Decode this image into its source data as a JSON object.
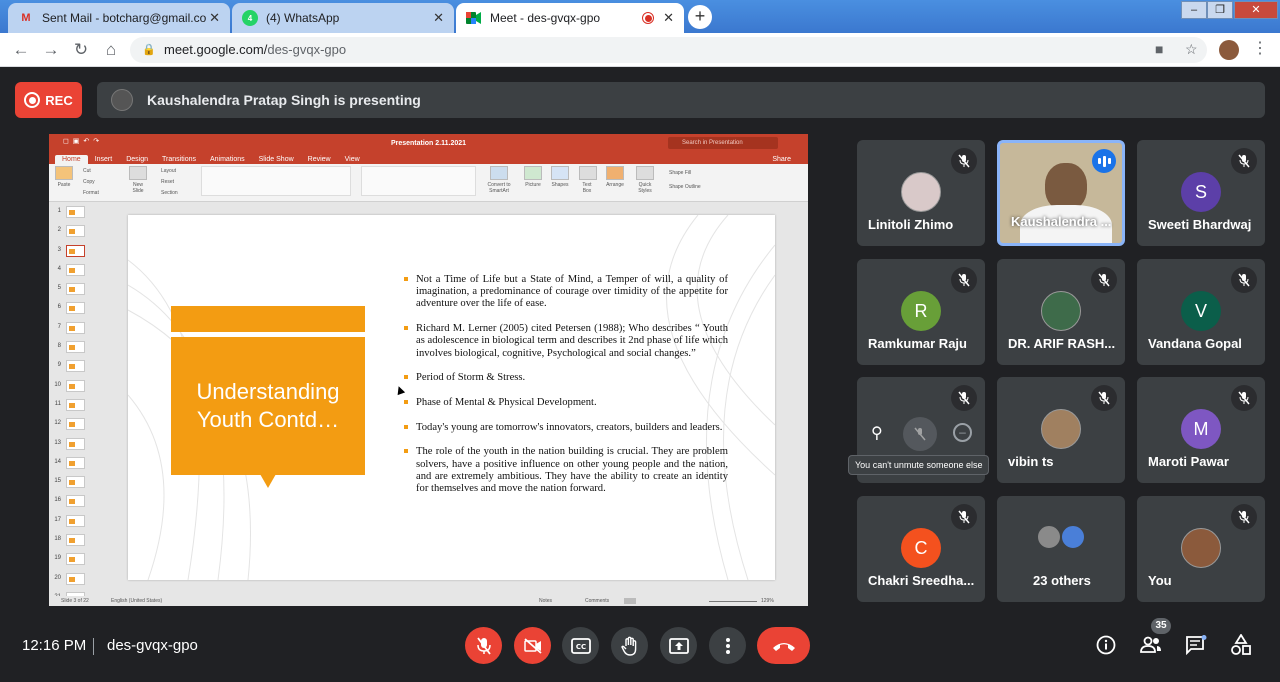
{
  "browser": {
    "tabs": [
      {
        "title": "Sent Mail - botcharg@gmail.com",
        "icon": "gmail-icon"
      },
      {
        "title": "(4) WhatsApp",
        "icon": "whatsapp-icon"
      },
      {
        "title": "Meet - des-gvqx-gpo",
        "icon": "meet-icon",
        "active": true
      }
    ],
    "url_host": "meet.google.com/",
    "url_path": "des-gvqx-gpo"
  },
  "meet": {
    "rec_label": "REC",
    "presenting_text": "Kaushalendra Pratap Singh is presenting",
    "time": "12:16 PM",
    "meeting_code": "des-gvqx-gpo",
    "participant_count": "35",
    "tooltip": "You can't unmute someone else",
    "participants": [
      {
        "name": "Linitoli Zhimo",
        "avatar": "photo",
        "muted": true
      },
      {
        "name": "Kaushalendra ...",
        "avatar": "video",
        "speaking": true
      },
      {
        "name": "Sweeti Bhardwaj",
        "avatar": "S",
        "color": "#5c3fa8",
        "muted": true
      },
      {
        "name": "Ramkumar Raju",
        "avatar": "R",
        "color": "#689f38",
        "muted": true
      },
      {
        "name": "DR. ARIF RASH...",
        "avatar": "photo",
        "muted": true
      },
      {
        "name": "Vandana Gopal",
        "avatar": "V",
        "color": "#0b5e4a",
        "muted": true
      },
      {
        "name": "",
        "avatar": "hover",
        "muted": true
      },
      {
        "name": "vibin ts",
        "avatar": "photo",
        "muted": true
      },
      {
        "name": "Maroti Pawar",
        "avatar": "M",
        "color": "#7e57c2",
        "muted": true
      },
      {
        "name": "Chakri Sreedha...",
        "avatar": "C",
        "color": "#f4511e",
        "muted": true
      },
      {
        "name": "23 others",
        "avatar": "group"
      },
      {
        "name": "You",
        "avatar": "photo",
        "muted": true
      }
    ]
  },
  "powerpoint": {
    "file_title": "Presentation 2.11.2021",
    "search_placeholder": "Search in Presentation",
    "ribbon_tabs": [
      "Home",
      "Insert",
      "Design",
      "Transitions",
      "Animations",
      "Slide Show",
      "Review",
      "View"
    ],
    "share_label": "Share",
    "ribbon_labels": {
      "paste": "Paste",
      "cut": "Cut",
      "copy": "Copy",
      "format": "Format",
      "new_slide": "New Slide",
      "layout": "Layout",
      "reset": "Reset",
      "section": "Section",
      "convert": "Convert to SmartArt",
      "picture": "Picture",
      "shapes": "Shapes",
      "text_box": "Text Box",
      "arrange": "Arrange",
      "quick_styles": "Quick Styles",
      "shape_fill": "Shape Fill",
      "shape_outline": "Shape Outline"
    },
    "slide_numbers": [
      "1",
      "2",
      "3",
      "4",
      "5",
      "6",
      "7",
      "8",
      "9",
      "10",
      "11",
      "12",
      "13",
      "14",
      "15",
      "16",
      "17",
      "18",
      "19",
      "20",
      "21"
    ],
    "slide_title": "Understanding Youth Contd…",
    "bullets": [
      "Not a Time of Life but a State of Mind, a Temper of will, a quality of imagination, a predominance of courage over timidity of the appetite for adventure over the life of ease.",
      "Richard M. Lerner (2005) cited Petersen (1988); Who describes “ Youth as adolescence in biological term and describes it 2nd phase of life which involves biological, cognitive, Psychological and social changes.”",
      "Period of Storm & Stress.",
      "Phase of Mental & Physical Development.",
      "Today's young are tomorrow's innovators, creators, builders and leaders.",
      "The role of the youth in the nation building is crucial. They are problem solvers, have a positive influence on other young people and the nation, and are extremely ambitious. They have the ability to create an identity for themselves and move the nation forward."
    ],
    "status_slide": "Slide 3 of 22",
    "status_lang": "English (United States)",
    "status_notes": "Notes",
    "status_comments": "Comments",
    "zoom": "129%"
  }
}
